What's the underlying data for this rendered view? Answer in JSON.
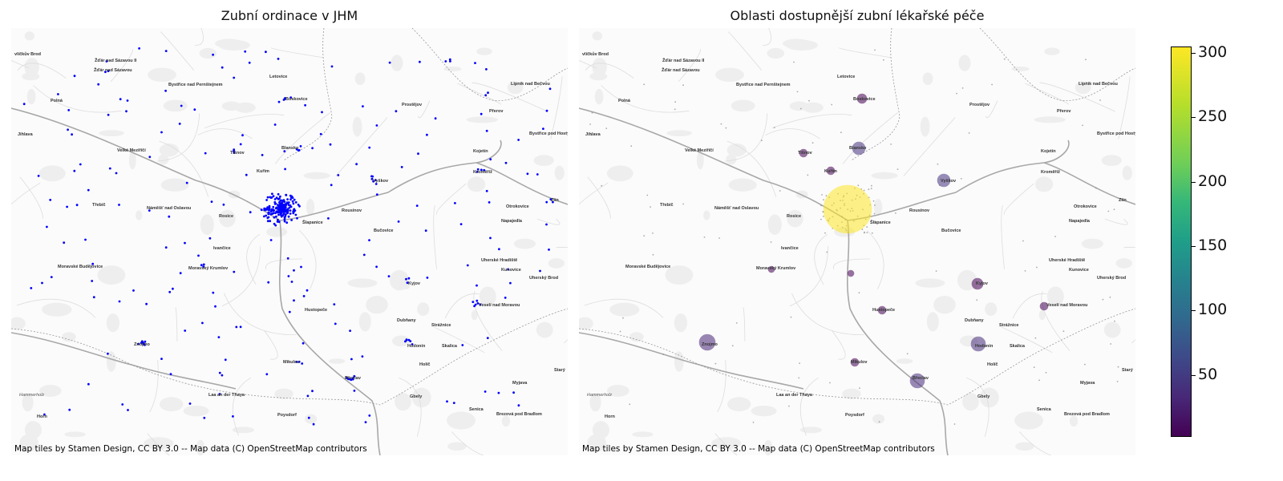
{
  "left_panel": {
    "title": "Zubní ordinace v JHM",
    "attribution": "Map tiles by Stamen Design, CC BY 3.0 -- Map data (C) OpenStreetMap contributors",
    "point_color": "#0000ff"
  },
  "right_panel": {
    "title": "Oblasti dostupnější zubní lékařské péče",
    "attribution": "Map tiles by Stamen Design, CC BY 3.0 -- Map data (C) OpenStreetMap contributors"
  },
  "colorbar": {
    "colormap": "viridis",
    "ticks": [
      "50",
      "100",
      "150",
      "200",
      "250",
      "300"
    ],
    "range": [
      3,
      305
    ]
  },
  "basemap_towns": [
    {
      "name": "vlíčkův Brod",
      "italic": false
    },
    {
      "name": "Žďár nad Sázavou II",
      "italic": false
    },
    {
      "name": "Žďár nad Sázavou",
      "italic": false
    },
    {
      "name": "Letovice",
      "italic": false
    },
    {
      "name": "Lipník nad Bečvou",
      "italic": false
    },
    {
      "name": "Bystřice nad Pernštejnem",
      "italic": false
    },
    {
      "name": "Boskovice",
      "italic": false
    },
    {
      "name": "Polná",
      "italic": false
    },
    {
      "name": "Prostějov",
      "italic": false
    },
    {
      "name": "Přerov",
      "italic": false
    },
    {
      "name": "Jihlava",
      "italic": false
    },
    {
      "name": "Bystřice pod Hostýnem",
      "italic": false
    },
    {
      "name": "Velké Meziříčí",
      "italic": false
    },
    {
      "name": "Tišnov",
      "italic": false
    },
    {
      "name": "Blansko",
      "italic": false
    },
    {
      "name": "Kojetín",
      "italic": false
    },
    {
      "name": "Kuřim",
      "italic": false
    },
    {
      "name": "Vyškov",
      "italic": false
    },
    {
      "name": "Kroměříž",
      "italic": false
    },
    {
      "name": "Zlín",
      "italic": false
    },
    {
      "name": "Třebíč",
      "italic": false
    },
    {
      "name": "Náměšť nad Oslavou",
      "italic": false
    },
    {
      "name": "Rousínov",
      "italic": false
    },
    {
      "name": "Otrokovice",
      "italic": false
    },
    {
      "name": "Rosice",
      "italic": false
    },
    {
      "name": "Šlapanice",
      "italic": false
    },
    {
      "name": "Napajedla",
      "italic": false
    },
    {
      "name": "Bučovice",
      "italic": false
    },
    {
      "name": "Ivančice",
      "italic": false
    },
    {
      "name": "Uherské Hradiště",
      "italic": false
    },
    {
      "name": "Moravské Budějovice",
      "italic": false
    },
    {
      "name": "Moravský Krumlov",
      "italic": false
    },
    {
      "name": "Kunovice",
      "italic": false
    },
    {
      "name": "Uherský Brod",
      "italic": false
    },
    {
      "name": "Kyjov",
      "italic": false
    },
    {
      "name": "Hustopeče",
      "italic": false
    },
    {
      "name": "Veselí nad Moravou",
      "italic": false
    },
    {
      "name": "Dubňany",
      "italic": false
    },
    {
      "name": "Strážnice",
      "italic": false
    },
    {
      "name": "Znojmo",
      "italic": false
    },
    {
      "name": "Hodonín",
      "italic": false
    },
    {
      "name": "Skalica",
      "italic": false
    },
    {
      "name": "Mikulov",
      "italic": false
    },
    {
      "name": "Holíč",
      "italic": false
    },
    {
      "name": "Starý",
      "italic": false
    },
    {
      "name": "Břeclav",
      "italic": false
    },
    {
      "name": "Myjava",
      "italic": false
    },
    {
      "name": "Hammerholz",
      "italic": true
    },
    {
      "name": "Laa an der Thaya",
      "italic": false
    },
    {
      "name": "Gbely",
      "italic": false
    },
    {
      "name": "Senica",
      "italic": false
    },
    {
      "name": "Horn",
      "italic": false
    },
    {
      "name": "Poysdorf",
      "italic": false
    },
    {
      "name": "Brezová pod Bradlom",
      "italic": false
    }
  ]
}
